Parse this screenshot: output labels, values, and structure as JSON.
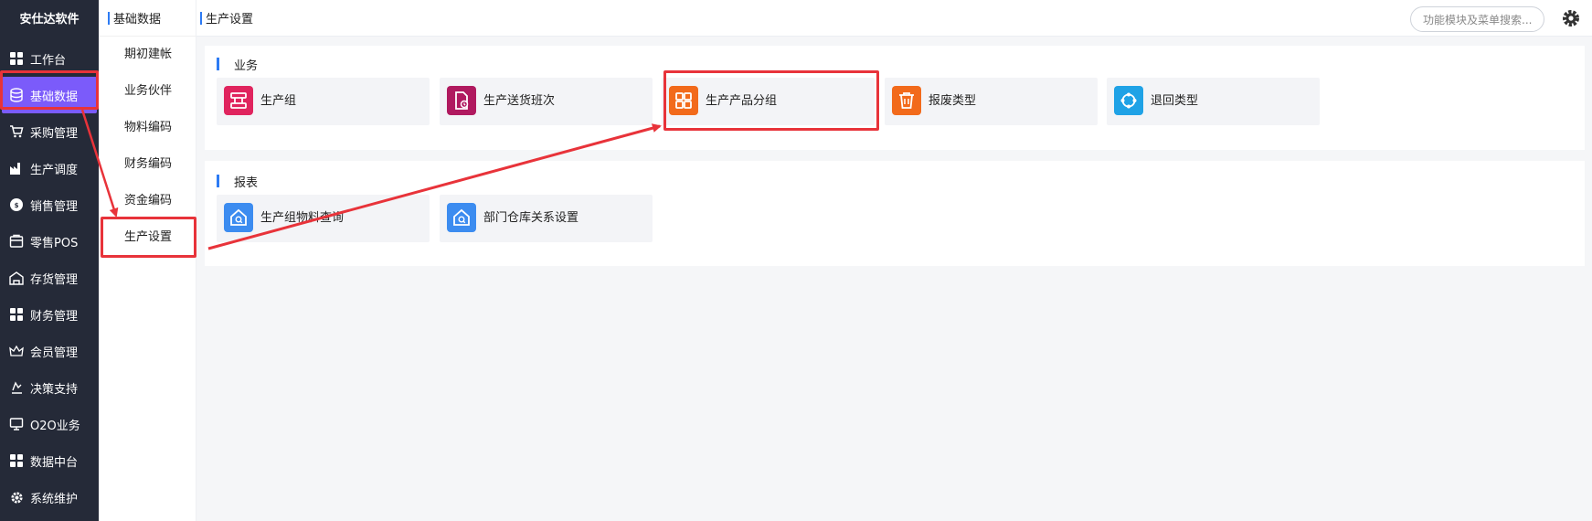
{
  "nav": {
    "brand": "安仕达软件",
    "items": [
      {
        "label": "工作台",
        "icon": "grid-icon"
      },
      {
        "label": "基础数据",
        "icon": "database-icon"
      },
      {
        "label": "采购管理",
        "icon": "cart-icon"
      },
      {
        "label": "生产调度",
        "icon": "factory-icon"
      },
      {
        "label": "销售管理",
        "icon": "sales-badge-icon"
      },
      {
        "label": "零售POS",
        "icon": "pos-icon"
      },
      {
        "label": "存货管理",
        "icon": "warehouse-icon"
      },
      {
        "label": "财务管理",
        "icon": "grid-icon"
      },
      {
        "label": "会员管理",
        "icon": "crown-icon"
      },
      {
        "label": "决策支持",
        "icon": "decision-icon"
      },
      {
        "label": "O2O业务",
        "icon": "monitor-icon"
      },
      {
        "label": "数据中台",
        "icon": "grid-icon"
      },
      {
        "label": "系统维护",
        "icon": "gear-icon"
      }
    ]
  },
  "sub": {
    "title": "基础数据",
    "items": [
      "期初建帐",
      "业务伙伴",
      "物料编码",
      "财务编码",
      "资金编码",
      "生产设置"
    ]
  },
  "topbar": {
    "breadcrumb": "生产设置",
    "search_placeholder": "功能模块及菜单搜索..."
  },
  "business": {
    "title": "业务",
    "cards": [
      {
        "label": "生产组",
        "color": "#e0245e"
      },
      {
        "label": "生产送货班次",
        "color": "#b0195f"
      },
      {
        "label": "生产产品分组",
        "color": "#f26a1b"
      },
      {
        "label": "报废类型",
        "color": "#f26a1b"
      },
      {
        "label": "退回类型",
        "color": "#1fa2e6"
      }
    ]
  },
  "reports": {
    "title": "报表",
    "cards": [
      {
        "label": "生产组物料查询",
        "color": "#3c8cf0"
      },
      {
        "label": "部门仓库关系设置",
        "color": "#3c8cf0"
      }
    ]
  },
  "colors": {
    "nav_bg": "#252a38",
    "nav_active": "#7b5bfa",
    "accent": "#2d7bf4",
    "annotation": "#e8333a"
  }
}
